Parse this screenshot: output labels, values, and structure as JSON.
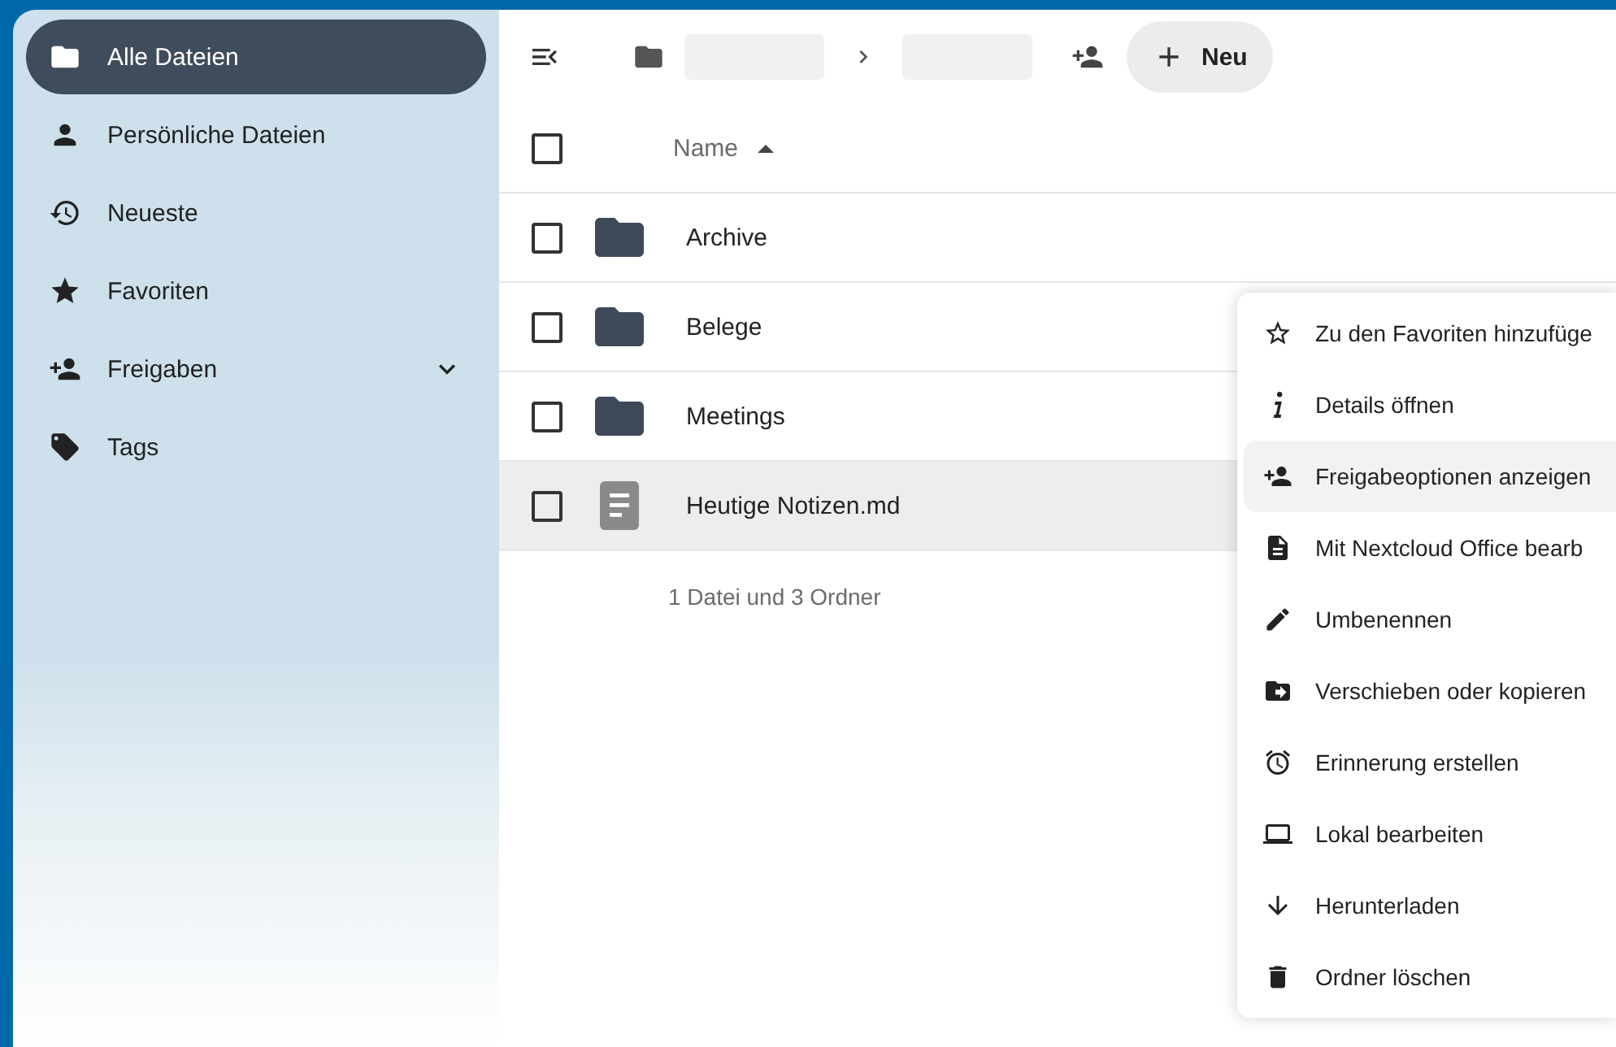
{
  "sidebar": {
    "items": [
      {
        "label": "Alle Dateien",
        "selected": true,
        "kind": "link"
      },
      {
        "label": "Persönliche Dateien",
        "selected": false,
        "kind": "link"
      },
      {
        "label": "Neueste",
        "selected": false,
        "kind": "link"
      },
      {
        "label": "Favoriten",
        "selected": false,
        "kind": "link"
      },
      {
        "label": "Freigaben",
        "selected": false,
        "kind": "group",
        "expanded": false
      },
      {
        "label": "Tags",
        "selected": false,
        "kind": "link"
      }
    ]
  },
  "toolbar": {
    "new_button": "Neu"
  },
  "table": {
    "select_all": {
      "checked": false
    },
    "columns": [
      {
        "label": "Name",
        "sort_ascending": true
      }
    ],
    "rows": [
      {
        "name": "Archive",
        "kind": "folder",
        "checked": false,
        "active": false
      },
      {
        "name": "Belege",
        "kind": "folder",
        "checked": false,
        "active": false
      },
      {
        "name": "Meetings",
        "kind": "folder",
        "checked": false,
        "active": false
      },
      {
        "name": "Heutige Notizen.md",
        "kind": "file",
        "checked": false,
        "active": true
      }
    ],
    "summary": "1 Datei und 3 Ordner"
  },
  "context_menu": {
    "items": [
      {
        "label": "Zu den Favoriten hinzufüge",
        "selected": false
      },
      {
        "label": "Details öffnen",
        "selected": false
      },
      {
        "label": "Freigabeoptionen anzeigen",
        "selected": true
      },
      {
        "label": "Mit Nextcloud Office bearb",
        "selected": false
      },
      {
        "label": "Umbenennen",
        "selected": false
      },
      {
        "label": "Verschieben oder kopieren",
        "selected": false
      },
      {
        "label": "Erinnerung erstellen",
        "selected": false
      },
      {
        "label": "Lokal bearbeiten",
        "selected": false
      },
      {
        "label": "Herunterladen",
        "selected": false
      },
      {
        "label": "Ordner löschen",
        "selected": false
      }
    ]
  }
}
